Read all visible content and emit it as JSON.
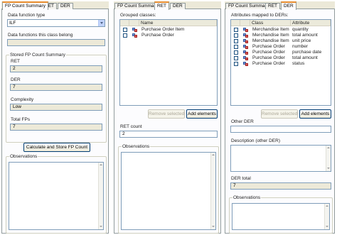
{
  "panel1": {
    "tabs": [
      "FP Count Summary",
      "RET",
      "DER"
    ],
    "data_function_type_label": "Data function type",
    "data_function_type_value": "ILF",
    "data_functions_label": "Data functions this class belong",
    "stored_summary_label": "Stored FP Count Summary",
    "ret_label": "RET",
    "ret_value": "2",
    "der_label": "DER",
    "der_value": "7",
    "complexity_label": "Complexity",
    "complexity_value": "Low",
    "total_fps_label": "Total FPs",
    "total_fps_value": "7",
    "calc_button": "Calculate and Store FP Count",
    "observations_label": "Observations"
  },
  "panel2": {
    "tabs": [
      "FP Count Summary",
      "RET",
      "DER"
    ],
    "grouped_classes_label": "Grouped classes:",
    "col_name": "Name",
    "rows": [
      "Purchase Order Item",
      "Purchase Order"
    ],
    "remove_button": "Remove selected",
    "add_button": "Add elements",
    "ret_count_label": "RET count",
    "ret_count_value": "2",
    "observations_label": "Observations"
  },
  "panel3": {
    "tabs": [
      "FP Count Summary",
      "RET",
      "DER"
    ],
    "attributes_label": "Attributes mapped to DERs:",
    "col_class": "Class",
    "col_attribute": "Attribute",
    "rows": [
      {
        "class": "Merchandise Item",
        "attribute": "quantity"
      },
      {
        "class": "Merchandise Item",
        "attribute": "total amount"
      },
      {
        "class": "Merchandise Item",
        "attribute": "unit price"
      },
      {
        "class": "Purchase Order",
        "attribute": "number"
      },
      {
        "class": "Purchase Order",
        "attribute": "purchase date"
      },
      {
        "class": "Purchase Order",
        "attribute": "total amount"
      },
      {
        "class": "Purchase Order",
        "attribute": "status"
      }
    ],
    "remove_button": "Remove selected",
    "add_button": "Add elements",
    "other_der_label": "Other DER",
    "description_label": "Description (other DER)",
    "der_total_label": "DER total",
    "der_total_value": "7",
    "observations_label": "Observations"
  }
}
